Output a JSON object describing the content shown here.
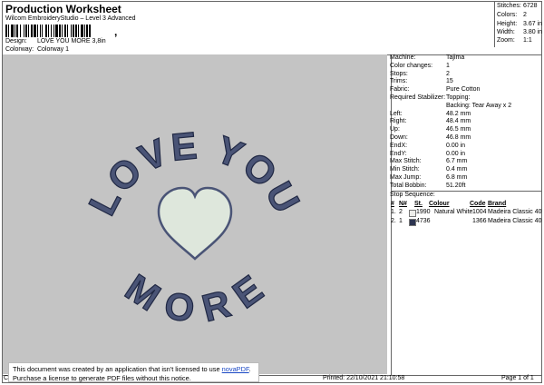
{
  "header": {
    "title": "Production Worksheet",
    "subtitle": "Wilcom EmbroideryStudio – Level 3 Advanced",
    "barcode_suffix": ","
  },
  "info": {
    "design_label": "Design:",
    "design_value": "LOVE YOU MORE 3,8in",
    "colorway_label": "Colorway:",
    "colorway_value": "Colorway 1"
  },
  "stats": {
    "stitches_label": "Stitches:",
    "stitches_value": "6728",
    "colors_label": "Colors:",
    "colors_value": "2",
    "height_label": "Height:",
    "height_value": "3.67 in",
    "width_label": "Width:",
    "width_value": "3.80 in",
    "zoom_label": "Zoom:",
    "zoom_value": "1:1"
  },
  "specs": [
    {
      "label": "Machine:",
      "value": "Tajima"
    },
    {
      "label": "Color changes:",
      "value": "1"
    },
    {
      "label": "Stops:",
      "value": "2"
    },
    {
      "label": "Trims:",
      "value": "15"
    },
    {
      "label": "Fabric:",
      "value": "Pure Cotton"
    },
    {
      "label": "Required Stabilizer:",
      "value": "Topping:"
    },
    {
      "label": "",
      "value": "Backing: Tear Away x 2"
    },
    {
      "label": "Left:",
      "value": "48.2 mm"
    },
    {
      "label": "Right:",
      "value": "48.4 mm"
    },
    {
      "label": "Up:",
      "value": "46.5 mm"
    },
    {
      "label": "Down:",
      "value": "46.8 mm"
    },
    {
      "label": "EndX:",
      "value": "0.00 in"
    },
    {
      "label": "EndY:",
      "value": "0.00 in"
    },
    {
      "label": "Max Stitch:",
      "value": "6.7 mm"
    },
    {
      "label": "Min Stitch:",
      "value": "0.4 mm"
    },
    {
      "label": "Max Jump:",
      "value": "6.8 mm"
    },
    {
      "label": "Total Bobbin:",
      "value": "51.20ft"
    }
  ],
  "stop_sequence": {
    "title": "Stop Sequence:",
    "headers": {
      "num": "#",
      "n": "N#",
      "st": "St.",
      "colour": "Colour",
      "code": "Code",
      "brand": "Brand"
    },
    "rows": [
      {
        "num": "1.",
        "n": "2",
        "st": "1990",
        "colour": "Natural White",
        "code": "1004",
        "brand": "Madeira Classic 40",
        "swatch": "#eeeeea"
      },
      {
        "num": "2.",
        "n": "1",
        "st": "4736",
        "colour": "",
        "code": "1366",
        "brand": "Madeira Classic 40",
        "swatch": "#2c3450"
      }
    ]
  },
  "design_text": {
    "top_arc": "LOVE YOU",
    "bottom_arc": "MORE"
  },
  "colors": {
    "canvas": "#c4c4c4",
    "lettering": "#4a5476",
    "lettering_outline": "#202844",
    "heart_fill": "#dee7dc",
    "heart_outline": "#4a5476"
  },
  "footer": {
    "left": "Cr",
    "printed": "Printed: 22/10/2021 21:10:58",
    "page": "Page 1 of 1"
  },
  "notice": {
    "line1_pre": "This document was created by an application that isn't licensed to use ",
    "link": "novaPDF",
    "line1_post": ".",
    "line2": "Purchase a license to generate PDF files without this notice."
  }
}
